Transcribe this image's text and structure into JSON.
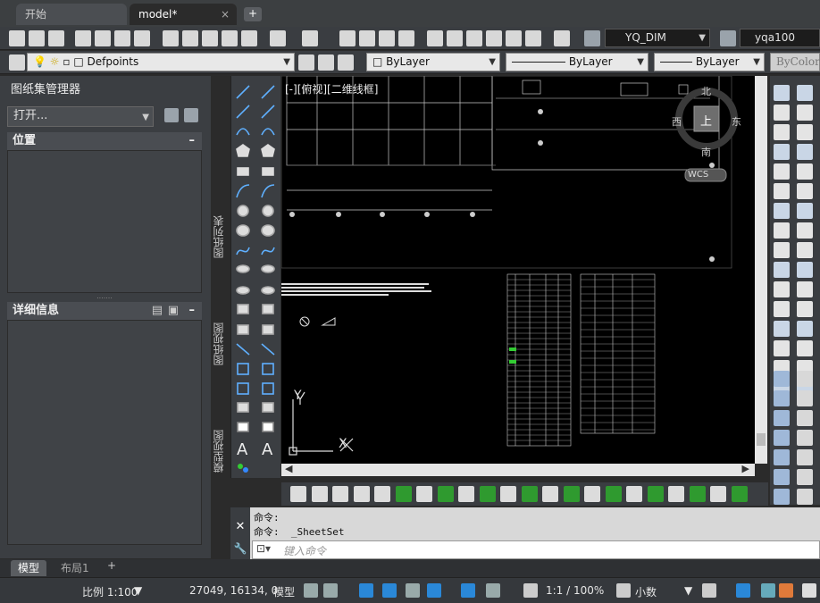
{
  "tabs": {
    "start_label": "开始",
    "model_label": "model*",
    "close_glyph": "×",
    "add_glyph": "+"
  },
  "toolbar": {
    "dim_style": "YQ_DIM",
    "text_style": "yqa100"
  },
  "layerbar": {
    "layer_name": "Defpoints",
    "color": "ByLayer",
    "linetype": "ByLayer",
    "lineweight": "ByLayer",
    "plotstyle": "ByColor"
  },
  "sheetset": {
    "title": "图纸集管理器",
    "open_label": "打开...",
    "location_header": "位置",
    "details_header": "详细信息",
    "collapse_glyph": "–",
    "vtab_list": "图纸列表",
    "vtab_view": "图纸视图",
    "vtab_model": "模型视图"
  },
  "viewport": {
    "label": "[-][俯视][二维线框]",
    "compass_top": "上",
    "north": "北",
    "south": "南",
    "east": "东",
    "west": "西",
    "wcs": "WCS",
    "axis_x": "X",
    "axis_y": "Y"
  },
  "command": {
    "line1": "命令:",
    "line2": "命令:  _SheetSet",
    "placeholder": "键入命令"
  },
  "layout_tabs": {
    "model": "模型",
    "layout1": "布局1",
    "add": "+"
  },
  "status": {
    "scale": "比例 1:100",
    "coords": "27049, 16134, 0",
    "model": "模型",
    "anno_scale": "1:1 / 100%",
    "units": "小数"
  },
  "colors": {
    "accent": "#2a88d8",
    "green_tool": "#2f9a2f"
  }
}
